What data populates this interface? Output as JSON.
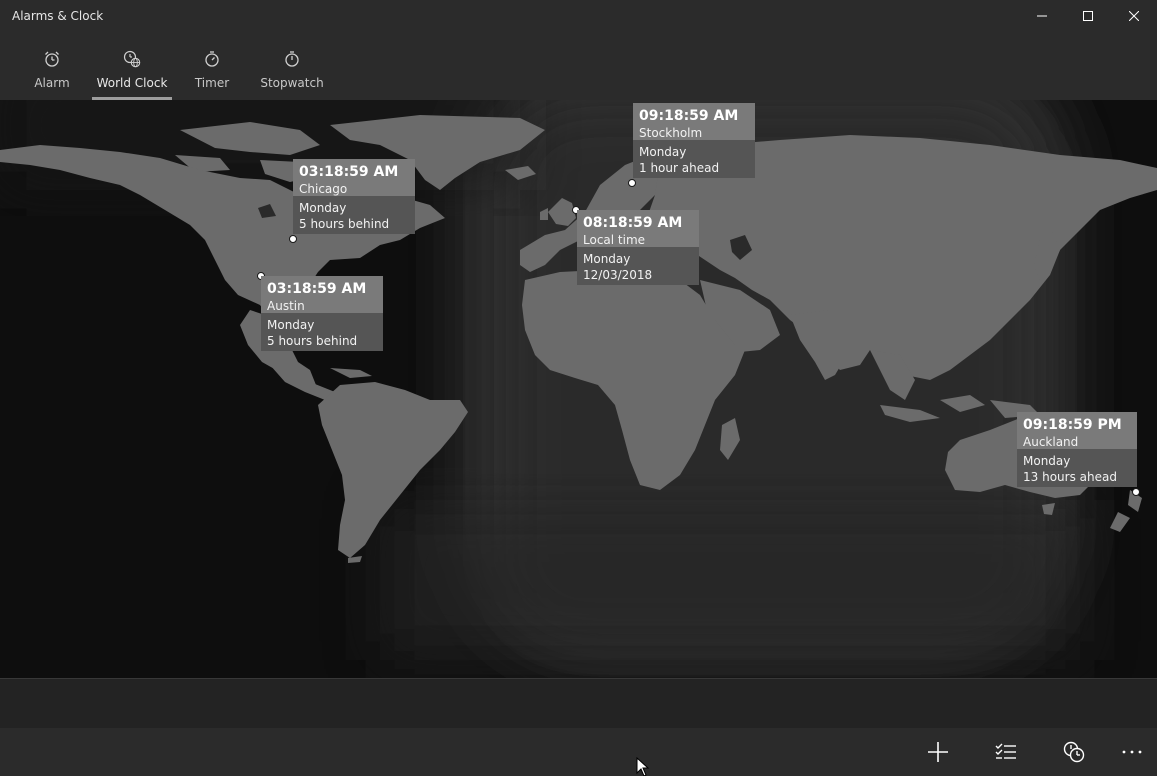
{
  "window": {
    "title": "Alarms & Clock",
    "controls": [
      "minimize-icon",
      "maximize-icon",
      "close-icon"
    ]
  },
  "nav": {
    "tabs": [
      {
        "label": "Alarm",
        "icon": "alarm-clock-icon",
        "selected": false
      },
      {
        "label": "World Clock",
        "icon": "world-clock-icon",
        "selected": true
      },
      {
        "label": "Timer",
        "icon": "timer-icon",
        "selected": false
      },
      {
        "label": "Stopwatch",
        "icon": "stopwatch-icon",
        "selected": false
      }
    ]
  },
  "clocks": {
    "stockholm": {
      "time": "09:18:59 AM",
      "city": "Stockholm",
      "day": "Monday",
      "diff": "1 hour ahead"
    },
    "chicago": {
      "time": "03:18:59 AM",
      "city": "Chicago",
      "day": "Monday",
      "diff": "5 hours behind"
    },
    "local": {
      "time": "08:18:59 AM",
      "city": "Local time",
      "day": "Monday",
      "diff": "12/03/2018"
    },
    "austin": {
      "time": "03:18:59 AM",
      "city": "Austin",
      "day": "Monday",
      "diff": "5 hours behind"
    },
    "auckland": {
      "time": "09:18:59 PM",
      "city": "Auckland",
      "day": "Monday",
      "diff": "13 hours ahead"
    }
  },
  "commands": [
    "add-icon",
    "select-list-icon",
    "compare-clocks-icon",
    "more-icon"
  ],
  "colors": {
    "land": "#6b6b6b",
    "night": "#0e0e0e",
    "day": "#2a2a2a",
    "card_top": "#7a7a7a",
    "card_bottom": "#555555"
  }
}
